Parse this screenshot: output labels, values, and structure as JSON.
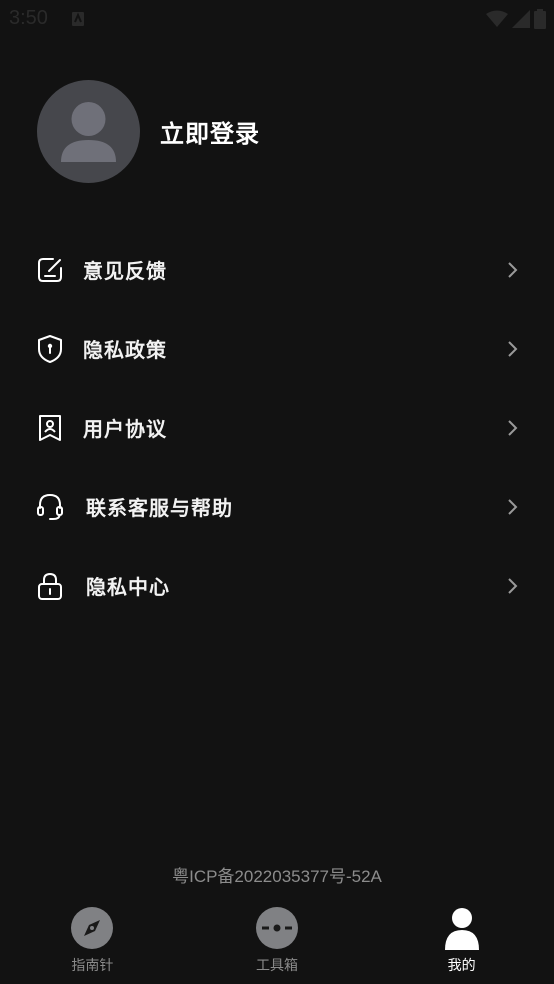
{
  "status_bar": {
    "time": "3:50"
  },
  "profile": {
    "login_label": "立即登录"
  },
  "menu": {
    "items": [
      {
        "label": "意见反馈",
        "icon": "feedback-edit-icon"
      },
      {
        "label": "隐私政策",
        "icon": "shield-icon"
      },
      {
        "label": "用户协议",
        "icon": "id-badge-icon"
      },
      {
        "label": "联系客服与帮助",
        "icon": "headset-icon"
      },
      {
        "label": "隐私中心",
        "icon": "lock-icon"
      }
    ]
  },
  "footer": {
    "icp": "粤ICP备2022035377号-52A"
  },
  "tabbar": {
    "tabs": [
      {
        "label": "指南针",
        "icon": "compass-icon",
        "active": false
      },
      {
        "label": "工具箱",
        "icon": "toolbox-icon",
        "active": false
      },
      {
        "label": "我的",
        "icon": "person-icon",
        "active": true
      }
    ]
  },
  "colors": {
    "background": "#121212",
    "avatar_bg": "#46474c",
    "avatar_fg": "#6f7079",
    "text_primary": "#ffffff",
    "text_secondary": "#8c8c8c",
    "chevron": "#9a9a9a"
  }
}
